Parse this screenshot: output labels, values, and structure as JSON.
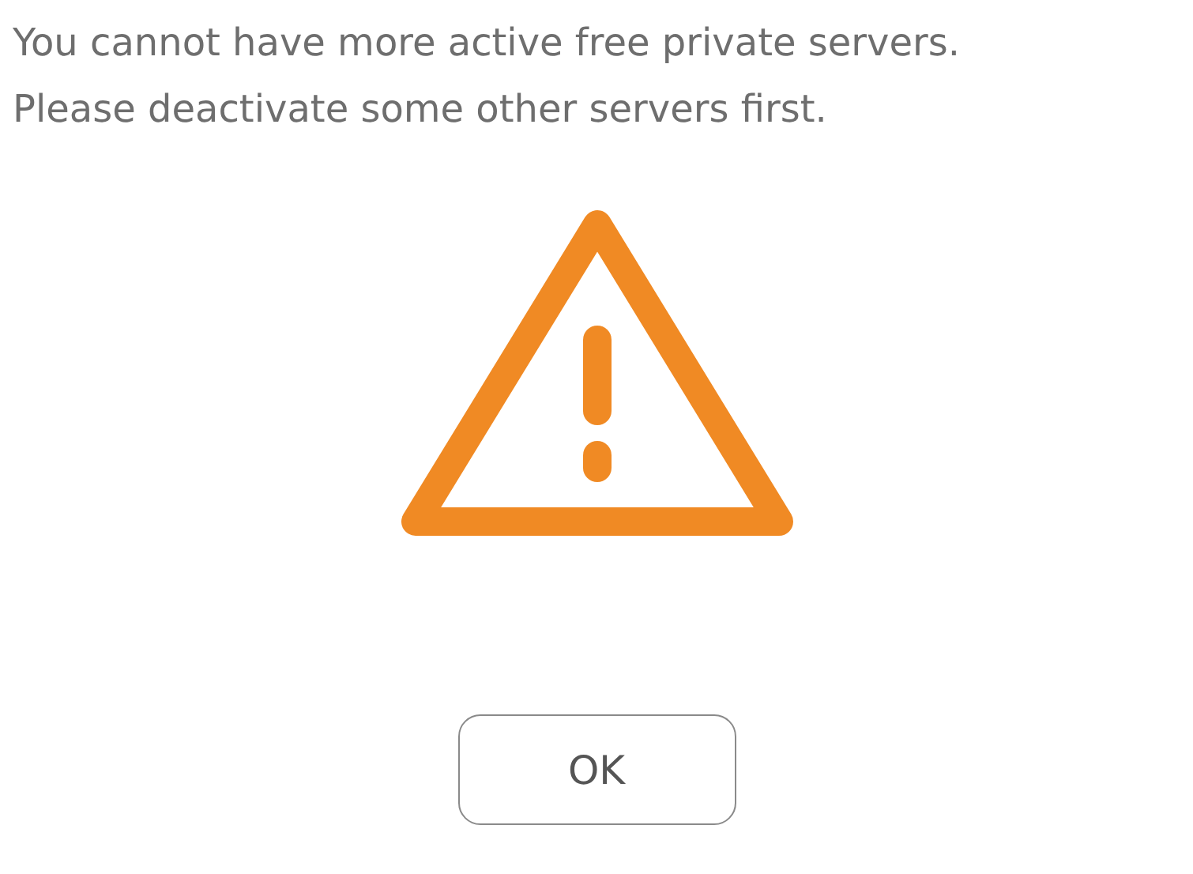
{
  "message": {
    "lines": [
      "You cannot have more active free private servers.",
      "Please deactivate some other servers first."
    ]
  },
  "buttons": [
    {
      "label": "OK"
    }
  ]
}
